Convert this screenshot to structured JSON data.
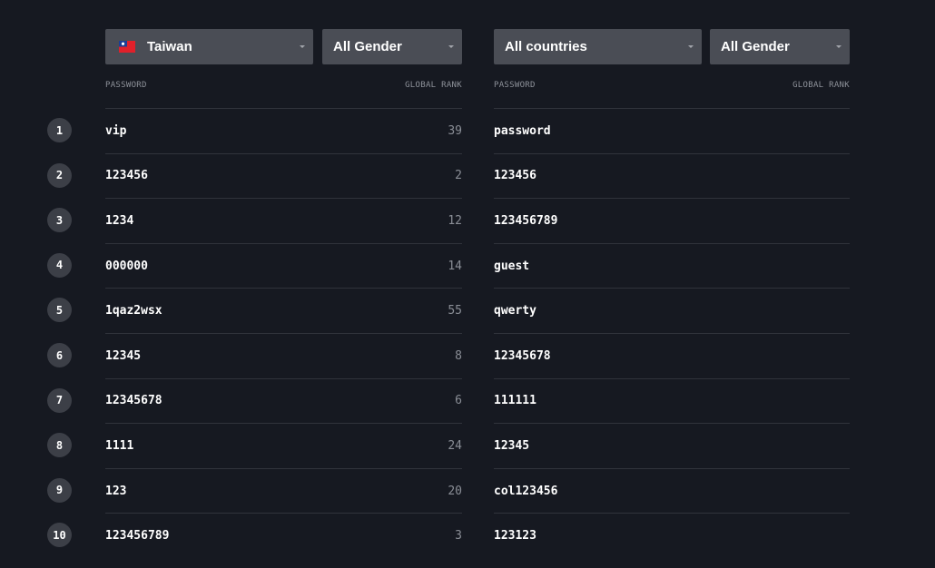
{
  "left": {
    "country_select": {
      "value": "Taiwan",
      "flag_icon": "taiwan-flag-icon"
    },
    "gender_select": {
      "value": "All Gender"
    },
    "headers": {
      "password": "PASSWORD",
      "global_rank": "GLOBAL RANK"
    },
    "rows": [
      {
        "password": "vip",
        "global_rank": "39"
      },
      {
        "password": "123456",
        "global_rank": "2"
      },
      {
        "password": "1234",
        "global_rank": "12"
      },
      {
        "password": "000000",
        "global_rank": "14"
      },
      {
        "password": "1qaz2wsx",
        "global_rank": "55"
      },
      {
        "password": "12345",
        "global_rank": "8"
      },
      {
        "password": "12345678",
        "global_rank": "6"
      },
      {
        "password": "1111",
        "global_rank": "24"
      },
      {
        "password": "123",
        "global_rank": "20"
      },
      {
        "password": "123456789",
        "global_rank": "3"
      }
    ]
  },
  "right": {
    "country_select": {
      "value": "All countries"
    },
    "gender_select": {
      "value": "All Gender"
    },
    "headers": {
      "password": "PASSWORD",
      "global_rank": "GLOBAL RANK"
    },
    "rows": [
      {
        "password": "password",
        "global_rank": ""
      },
      {
        "password": "123456",
        "global_rank": ""
      },
      {
        "password": "123456789",
        "global_rank": ""
      },
      {
        "password": "guest",
        "global_rank": ""
      },
      {
        "password": "qwerty",
        "global_rank": ""
      },
      {
        "password": "12345678",
        "global_rank": ""
      },
      {
        "password": "111111",
        "global_rank": ""
      },
      {
        "password": "12345",
        "global_rank": ""
      },
      {
        "password": "col123456",
        "global_rank": ""
      },
      {
        "password": "123123",
        "global_rank": ""
      }
    ]
  },
  "ranks": [
    "1",
    "2",
    "3",
    "4",
    "5",
    "6",
    "7",
    "8",
    "9",
    "10"
  ],
  "colors": {
    "background": "#161921",
    "select_bg": "#4a4d55",
    "rank_circle": "#3c3f47",
    "divider": "#30333b",
    "muted_text": "#8a8e96"
  }
}
